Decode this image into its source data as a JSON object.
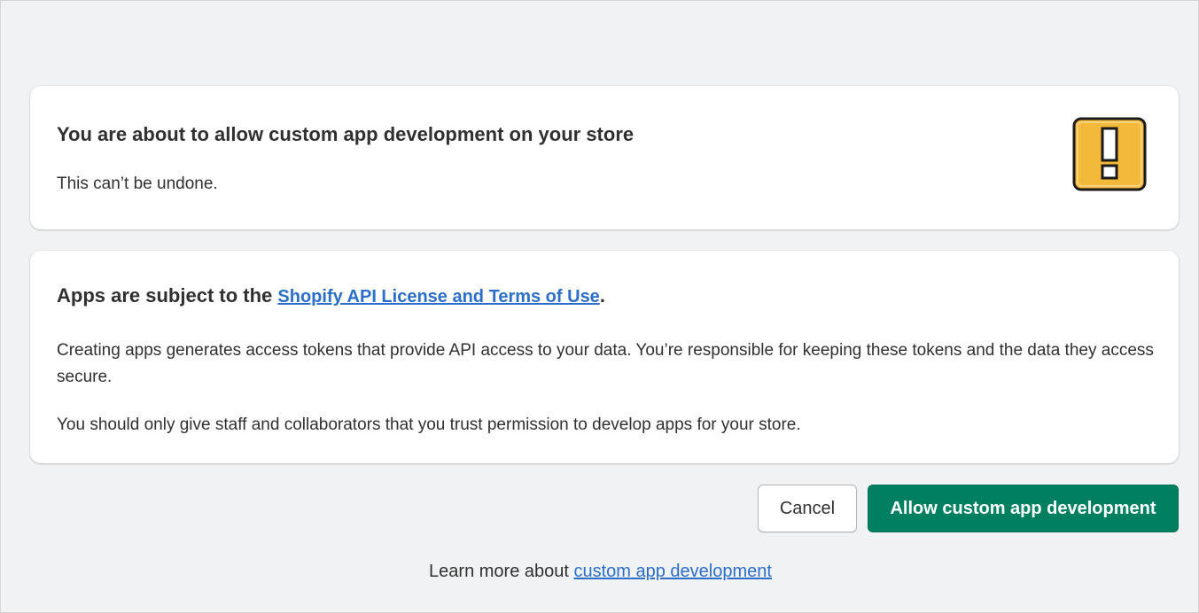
{
  "warning_card": {
    "title": "You are about to allow custom app development on your store",
    "subtitle": "This can’t be undone.",
    "icon": "exclamation-icon",
    "icon_color": "#f3b93a"
  },
  "terms_card": {
    "title_prefix": "Apps are subject to the ",
    "title_link": "Shopify API License and Terms of Use",
    "title_suffix": ".",
    "paragraph_1": "Creating apps generates access tokens that provide API access to your data. You’re responsible for keeping these tokens and the data they access secure.",
    "paragraph_2": "You should only give staff and collaborators that you trust permission to develop apps for your store."
  },
  "actions": {
    "cancel_label": "Cancel",
    "allow_label": "Allow custom app development",
    "allow_color": "#008060"
  },
  "footer": {
    "learn_prefix": "Learn more about ",
    "learn_link": "custom app development"
  },
  "link_color": "#2c6ecb"
}
